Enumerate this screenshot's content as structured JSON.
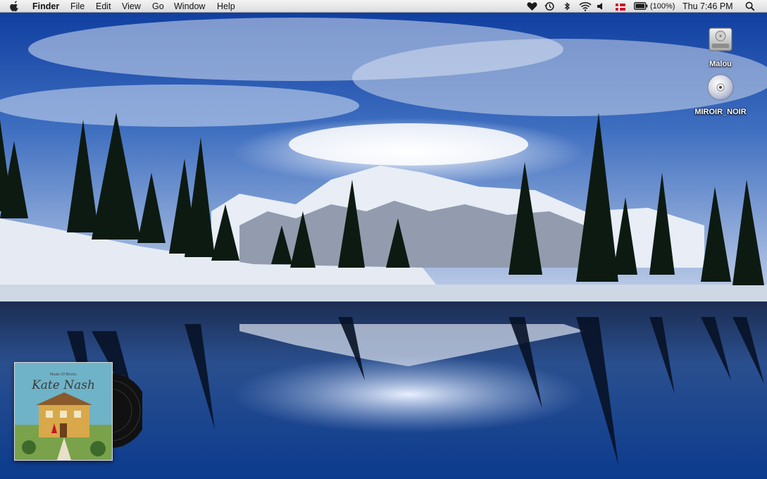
{
  "menubar": {
    "apple_glyph": "",
    "app_name": "Finder",
    "menus": [
      "File",
      "Edit",
      "View",
      "Go",
      "Window",
      "Help"
    ],
    "status_icons": [
      "heart-icon",
      "time-machine-icon",
      "bluetooth-icon",
      "wifi-icon",
      "volume-icon",
      "flag-icon",
      "battery-icon"
    ],
    "battery_text": "(100%)",
    "clock": "Thu 7:46 PM",
    "spotlight_icon": "magnifier-icon"
  },
  "desktop": {
    "items": [
      {
        "label": "Malou",
        "icon": "hard-drive-icon"
      },
      {
        "label": "MIROIR_NOIR",
        "icon": "dvd-disc-icon"
      }
    ]
  },
  "album_widget": {
    "artist": "Kate Nash",
    "small_text": "Made Of Bricks",
    "cover_colors": {
      "sky": "#6fb3c8",
      "house": "#d8a84a",
      "roof": "#8a5a2a",
      "grass": "#7aa24a"
    }
  },
  "colors": {
    "menubar_top": "#f4f4f4",
    "menubar_bottom": "#dcdcdc",
    "sky_top": "#0e3fa0",
    "sky_bottom": "#6f96cf",
    "water": "#0b1f45"
  }
}
